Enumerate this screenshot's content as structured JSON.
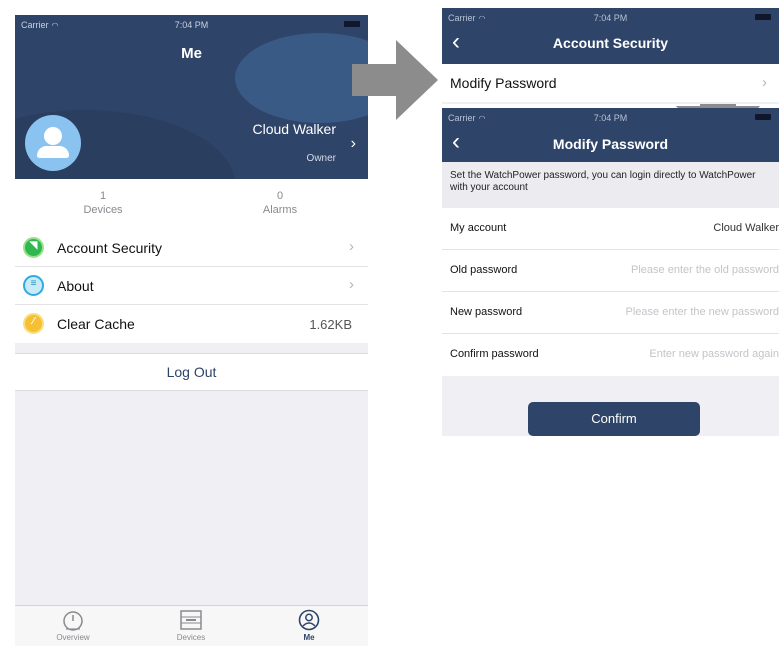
{
  "colors": {
    "navy": "#2e4468",
    "background": "#efeff4",
    "chevron": "#b5b5ba"
  },
  "left_screen": {
    "status": {
      "carrier": "Carrier",
      "time": "7:04 PM"
    },
    "header_title": "Me",
    "user": {
      "name": "Cloud Walker",
      "role": "Owner",
      "avatar_icon": "user-avatar-icon"
    },
    "stats": [
      {
        "value": "1",
        "label": "Devices"
      },
      {
        "value": "0",
        "label": "Alarms"
      }
    ],
    "menu": [
      {
        "label": "Account Security",
        "icon": "shield-icon",
        "trailing": "chevron"
      },
      {
        "label": "About",
        "icon": "document-icon",
        "trailing": "chevron"
      },
      {
        "label": "Clear Cache",
        "icon": "broom-icon",
        "value": "1.62KB"
      }
    ],
    "logout_label": "Log Out",
    "tabs": [
      {
        "label": "Overview",
        "icon": "gauge-icon"
      },
      {
        "label": "Devices",
        "icon": "device-icon"
      },
      {
        "label": "Me",
        "icon": "person-icon",
        "active": true
      }
    ]
  },
  "security_screen": {
    "status": {
      "carrier": "Carrier",
      "time": "7:04 PM"
    },
    "title": "Account Security",
    "row_label": "Modify Password"
  },
  "modify_screen": {
    "status": {
      "carrier": "Carrier",
      "time": "7:04 PM"
    },
    "title": "Modify Password",
    "info": "Set the WatchPower password, you can login directly to WatchPower with your account",
    "account": {
      "label": "My account",
      "value": "Cloud Walker"
    },
    "old_password": {
      "label": "Old password",
      "placeholder": "Please enter the old password"
    },
    "new_password": {
      "label": "New password",
      "placeholder": "Please enter the new password"
    },
    "confirm_password": {
      "label": "Confirm password",
      "placeholder": "Enter new password again"
    },
    "confirm_label": "Confirm"
  }
}
